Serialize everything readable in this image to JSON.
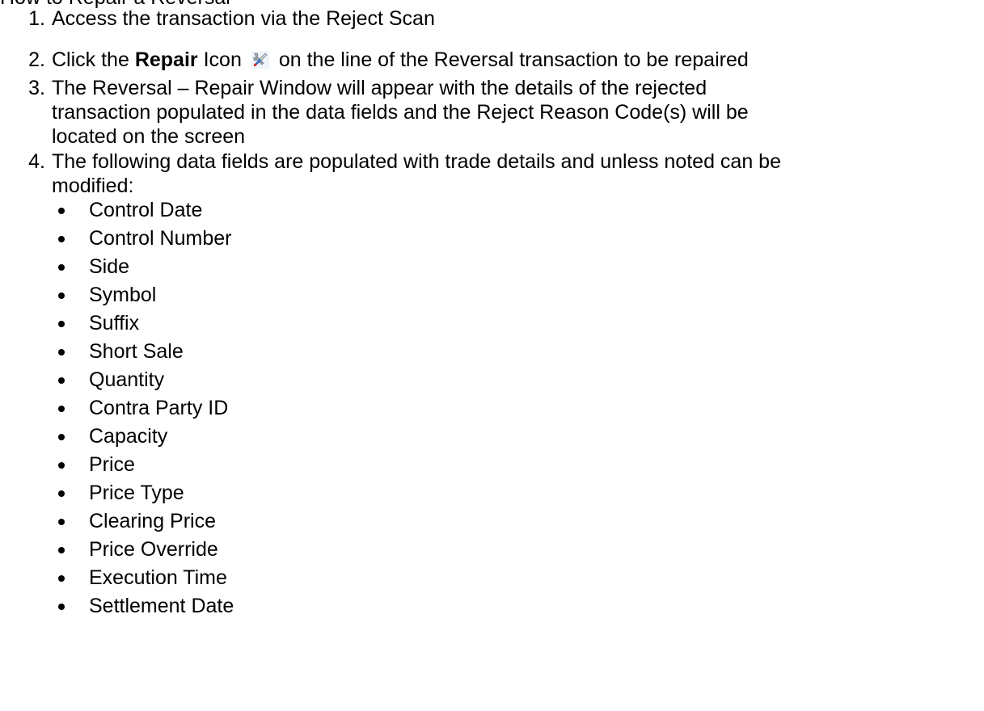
{
  "heading_partial": "How to Repair a Reversal",
  "steps": [
    {
      "number": "1.",
      "line1": "Access the transaction via the Reject Scan"
    },
    {
      "number": "2.",
      "prefix": "Click the",
      "bold": "Repair",
      "mid": "Icon",
      "icon": "repair-tools-icon",
      "suffix": "on the line of the Reversal transaction to be repaired"
    },
    {
      "number": "3.",
      "line1": "The Reversal – Repair Window will appear with the details of the rejected",
      "line2": "transaction populated in the data fields and the Reject Reason Code(s) will be",
      "line3": "located on the screen"
    },
    {
      "number": "4.",
      "line1": "The following data fields are populated with trade details and unless noted can be",
      "line2": "modified:"
    }
  ],
  "fields": [
    "Control Date",
    "Control Number",
    "Side",
    "Symbol",
    "Suffix",
    "Short Sale",
    "Quantity",
    "Contra Party ID",
    "Capacity",
    "Price",
    "Price Type",
    "Clearing Price",
    "Price Override",
    "Execution Time",
    "Settlement Date"
  ],
  "colors": {
    "text": "#000000",
    "background": "#ffffff",
    "icon_blue": "#2f6fc4",
    "icon_red": "#d2271c",
    "icon_steel": "#9aa4ae"
  }
}
